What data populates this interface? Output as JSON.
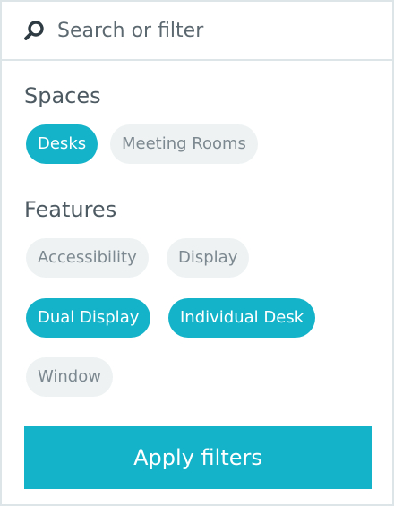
{
  "search": {
    "placeholder": "Search or filter",
    "icon": "search-icon"
  },
  "spaces": {
    "title": "Spaces",
    "chips": [
      {
        "label": "Desks",
        "selected": true
      },
      {
        "label": "Meeting Rooms",
        "selected": false
      }
    ]
  },
  "features": {
    "title": "Features",
    "chips": [
      {
        "label": "Accessibility",
        "selected": false
      },
      {
        "label": "Display",
        "selected": false
      },
      {
        "label": "Dual Display",
        "selected": true
      },
      {
        "label": "Individual Desk",
        "selected": true
      },
      {
        "label": "Window",
        "selected": false
      }
    ]
  },
  "apply_button": {
    "label": "Apply filters"
  },
  "colors": {
    "accent": "#14b3c9",
    "chip_inactive_bg": "#eef2f3",
    "chip_inactive_text": "#7d8990",
    "border": "#dde5e8",
    "heading": "#4d5a62"
  }
}
